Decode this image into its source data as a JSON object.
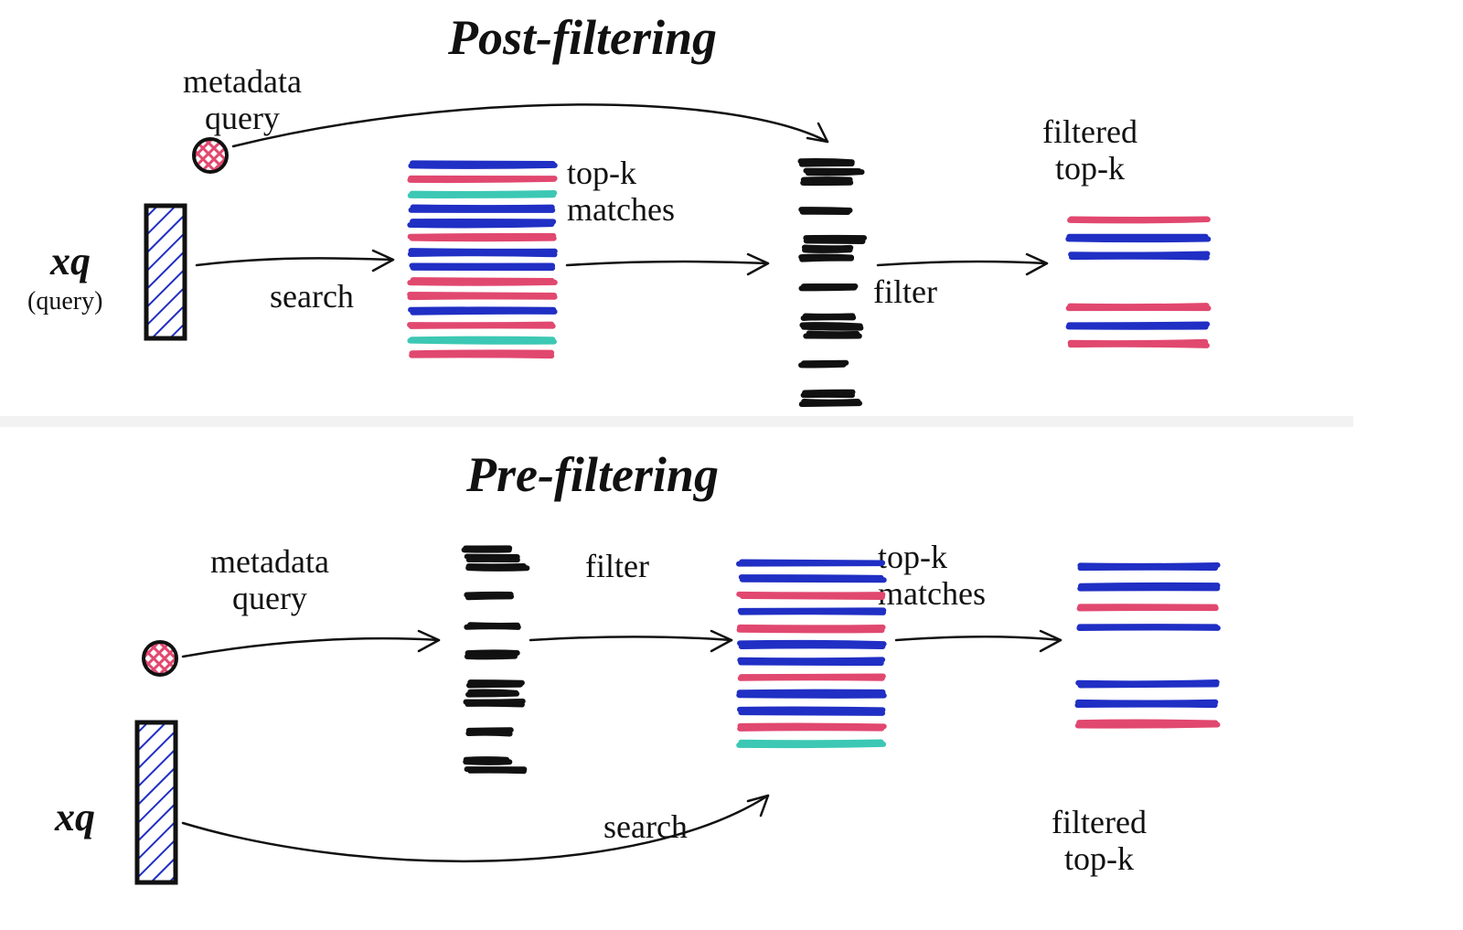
{
  "titles": {
    "post": "Post-filtering",
    "pre": "Pre-filtering"
  },
  "labels": {
    "metadata_query": "metadata\nquery",
    "xq": "xq",
    "query_sub": "(query)",
    "search": "search",
    "filter": "filter",
    "topk_matches": "top-k\nmatches",
    "filtered_topk": "filtered\ntop-k"
  },
  "colors": {
    "blue": "#202fc4",
    "pink": "#e1486f",
    "teal": "#3cc8b4",
    "black": "#111111"
  },
  "diagram": {
    "post": {
      "flow": [
        "query_vector + metadata_query",
        "search (full index)",
        "top-k matches",
        "apply metadata filter",
        "filtered top-k"
      ],
      "full_index_lines": [
        "blue",
        "pink",
        "teal",
        "blue",
        "blue",
        "pink",
        "blue",
        "blue",
        "pink",
        "pink",
        "blue",
        "pink",
        "teal",
        "pink"
      ],
      "mask_groups": [
        3,
        1,
        3,
        1,
        3,
        1,
        2
      ],
      "filtered_result": [
        "pink",
        "blue",
        "blue",
        "gap",
        "pink",
        "blue",
        "pink"
      ]
    },
    "pre": {
      "flow": [
        "metadata_query",
        "mask (filter)",
        "apply to index + search with xq",
        "top-k matches",
        "filtered top-k"
      ],
      "mask_groups": [
        3,
        1,
        1,
        1,
        3,
        1,
        2
      ],
      "filtered_index_lines": [
        "blue",
        "blue",
        "pink",
        "blue",
        "pink",
        "blue",
        "blue",
        "pink",
        "blue",
        "blue",
        "pink",
        "teal"
      ],
      "filtered_result": [
        "blue",
        "blue",
        "pink",
        "blue",
        "gap",
        "blue",
        "blue",
        "pink"
      ]
    }
  }
}
